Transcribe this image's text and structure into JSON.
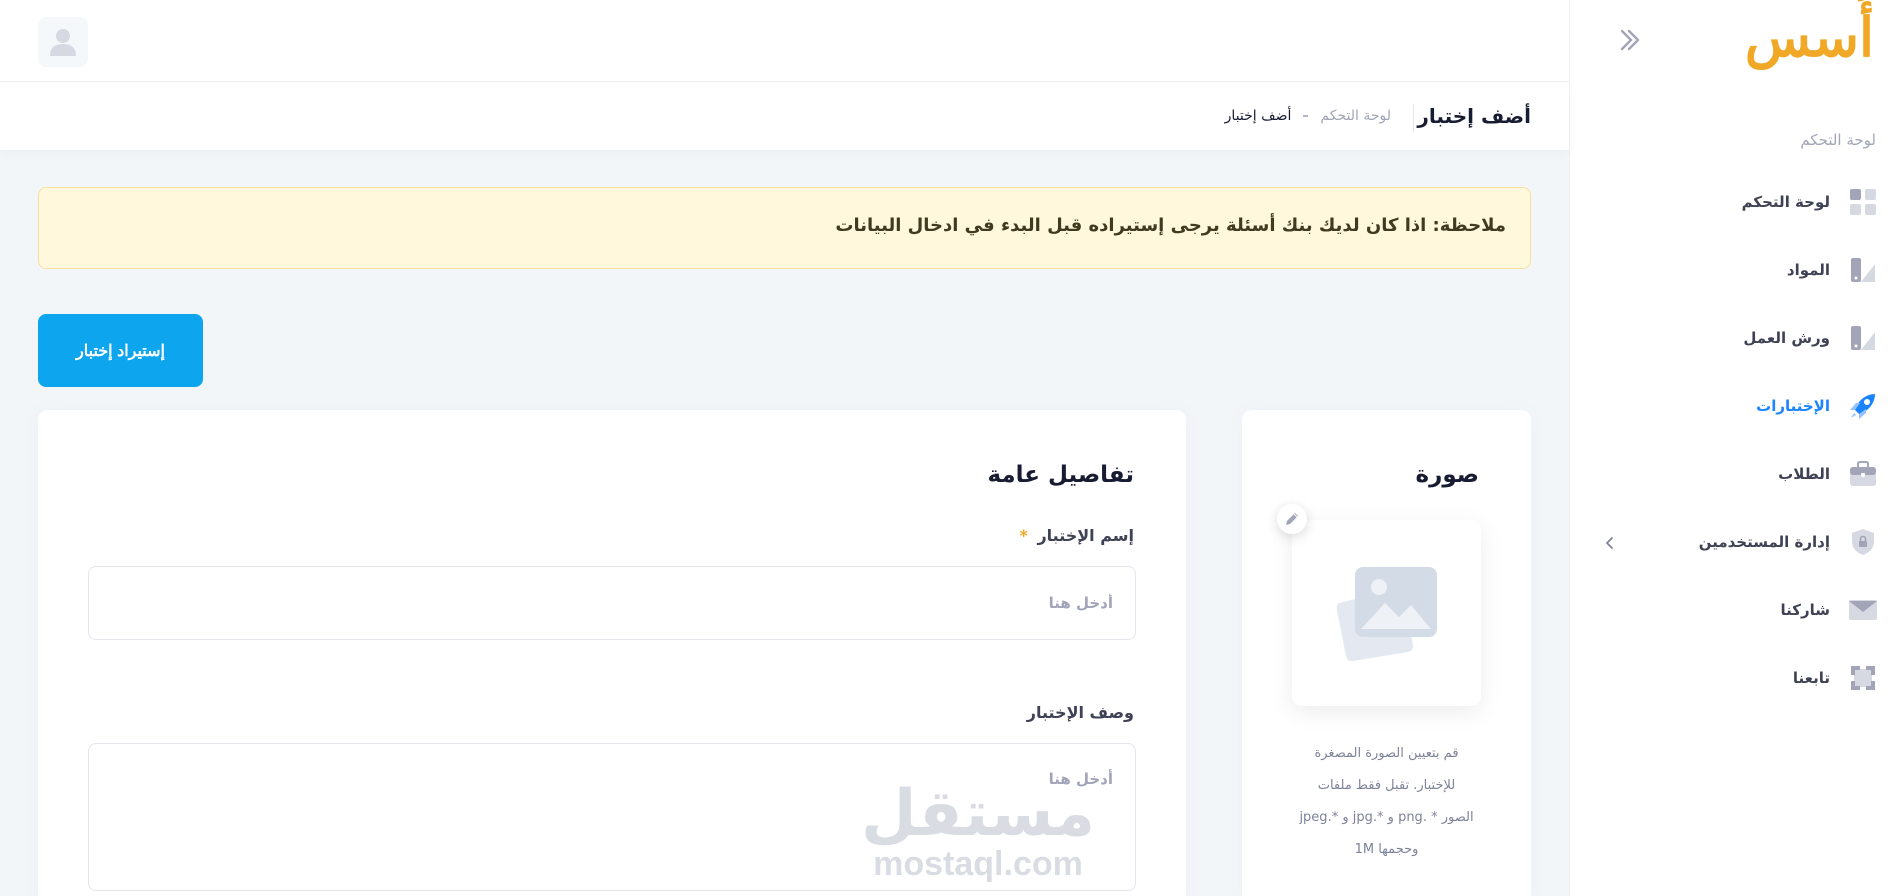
{
  "app": {
    "logo_text": "أُسس"
  },
  "sidebar": {
    "section_title": "لوحة التحكم",
    "items": [
      {
        "label": "لوحة التحكم",
        "icon": "dashboard-icon",
        "active": false
      },
      {
        "label": "المواد",
        "icon": "book-icon",
        "active": false
      },
      {
        "label": "ورش العمل",
        "icon": "book-icon",
        "active": false
      },
      {
        "label": "الإختبارات",
        "icon": "rocket-icon",
        "active": true
      },
      {
        "label": "الطلاب",
        "icon": "briefcase-icon",
        "active": false
      },
      {
        "label": "إدارة المستخدمين",
        "icon": "shield-lock-icon",
        "active": false,
        "has_submenu": true
      },
      {
        "label": "شاركنا",
        "icon": "envelope-icon",
        "active": false
      },
      {
        "label": "تابعنا",
        "icon": "frame-icon",
        "active": false
      }
    ],
    "accent_color": "#1b84ff"
  },
  "topbar": {
    "avatar_icon": "user-icon"
  },
  "toolbar": {
    "page_title": "أضف إختبار",
    "breadcrumb": {
      "home": "لوحة التحكم",
      "current": "أضف إختبار"
    }
  },
  "notice": {
    "text": "ملاحظة: اذا كان لديك بنك أسئلة يرجى إستيراده قبل البدء في ادخال البيانات",
    "bg_color": "#fff8dd"
  },
  "import_button": {
    "label": "إستيراد إختبار",
    "color": "#0ea5ef"
  },
  "image_card": {
    "title": "صورة",
    "placeholder_icon": "image-placeholder-icon",
    "edit_icon": "pencil-icon",
    "hint_lines": [
      "قم بتعيين الصورة المصغرة",
      "للإختبار. تقبل فقط ملفات",
      "الصور * .png و *.jpg و *.jpeg",
      "وحجمها 1M"
    ]
  },
  "details_card": {
    "title": "تفاصيل عامة",
    "name_field": {
      "label": "إسم الإختبار",
      "required_mark": "*",
      "placeholder": "أدخل هنا",
      "value": ""
    },
    "description_field": {
      "label": "وصف الإختبار",
      "placeholder": "أدخل هنا",
      "value": ""
    }
  },
  "watermark": {
    "arabic": "مستقل",
    "latin": "mostaql.com"
  }
}
